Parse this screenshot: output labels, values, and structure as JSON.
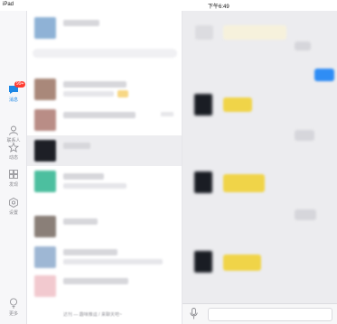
{
  "status": {
    "carrier": "iPad",
    "time": "下午6:49"
  },
  "tabs": [
    {
      "label": "消息",
      "badge": "99+",
      "icon": "message-icon",
      "active": true
    },
    {
      "label": "联系人",
      "icon": "contacts-icon",
      "active": false
    },
    {
      "label": "动态",
      "icon": "star-icon",
      "active": false
    },
    {
      "label": "发现",
      "icon": "grid-icon",
      "active": false
    },
    {
      "label": "设置",
      "icon": "settings-gear-icon",
      "active": false
    },
    {
      "label": "更多",
      "icon": "bulb-icon",
      "active": false
    }
  ],
  "conversations_footer": "达刊 — 趣味推运 / 来聊天吧~",
  "colors": {
    "accent": "#1e88e5",
    "badge": "#ff3b30",
    "bubble_yellow": "#f0d448",
    "bubble_blue": "#2f8df5"
  }
}
